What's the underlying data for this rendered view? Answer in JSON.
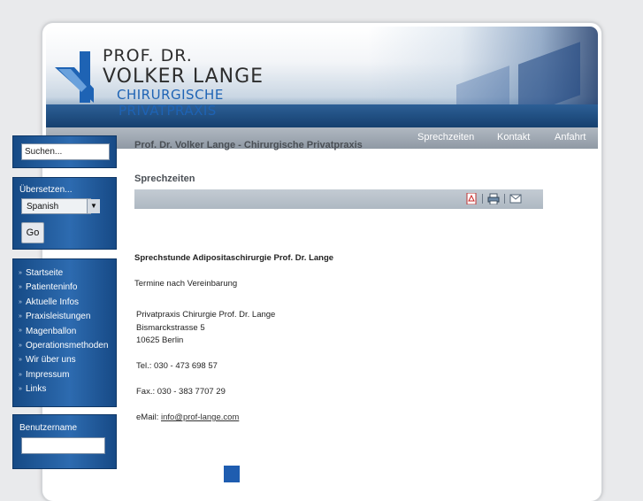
{
  "logo": {
    "line1": "PROF. DR.",
    "line2": "VOLKER LANGE",
    "line3": "CHIRURGISCHE",
    "line4": "PRIVATPRAXIS"
  },
  "nav": {
    "items": [
      "Sprechzeiten",
      "Kontakt",
      "Anfahrt"
    ]
  },
  "sidebar": {
    "search_placeholder": "Suchen...",
    "translate_label": "Übersetzen...",
    "language_selected": "Spanish",
    "go_label": "Go",
    "menu": [
      "Startseite",
      "Patienteninfo",
      "Aktuelle Infos",
      "Praxisleistungen",
      "Magenballon",
      "Operationsmethoden",
      "Wir über uns",
      "Impressum",
      "Links"
    ],
    "username_label": "Benutzername"
  },
  "content": {
    "site_title": "Prof. Dr. Volker Lange - Chirurgische Privatpraxis",
    "section_title": "Sprechzeiten",
    "heading": "Sprechstunde Adipositaschirurgie Prof. Dr. Lange",
    "appointment": "Termine nach Vereinbarung",
    "address_line1": "Privatpraxis Chirurgie Prof. Dr. Lange",
    "address_line2": "Bismarckstrasse 5",
    "address_line3": "10625 Berlin",
    "phone": "Tel.: 030 - 473 698 57",
    "fax": "Fax.: 030 - 383 7707 29",
    "email_label": "eMail: ",
    "email": "info@prof-lange.com"
  },
  "icons": [
    "pdf-icon",
    "print-icon",
    "email-icon"
  ],
  "colors": {
    "brand_blue": "#1e63b4",
    "sidebar_blue": "#2d6bb0",
    "nav_gray": "#9aa4ae"
  }
}
